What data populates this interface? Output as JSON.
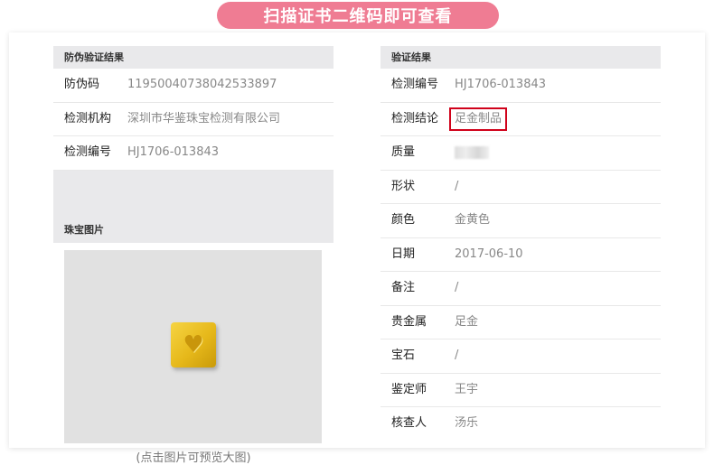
{
  "banner": {
    "title": "扫描证书二维码即可查看"
  },
  "anti_fake": {
    "heading": "防伪验证结果",
    "rows": [
      {
        "label": "防伪码",
        "value": "11950040738042533897"
      },
      {
        "label": "检测机构",
        "value": "深圳市华鉴珠宝检测有限公司"
      },
      {
        "label": "检测编号",
        "value": "HJ1706-013843"
      }
    ]
  },
  "photo": {
    "heading": "珠宝图片",
    "caption": "(点击图片可预览大图)"
  },
  "verify": {
    "heading": "验证结果",
    "rows": [
      {
        "label": "检测编号",
        "value": "HJ1706-013843"
      },
      {
        "label": "检测结论",
        "value": "足金制品"
      },
      {
        "label": "质量",
        "value": ""
      },
      {
        "label": "形状",
        "value": "/"
      },
      {
        "label": "颜色",
        "value": "金黄色"
      },
      {
        "label": "日期",
        "value": "2017-06-10"
      },
      {
        "label": "备注",
        "value": "/"
      },
      {
        "label": "贵金属",
        "value": "足金"
      },
      {
        "label": "宝石",
        "value": "/"
      },
      {
        "label": "鉴定师",
        "value": "王宇"
      },
      {
        "label": "核查人",
        "value": "汤乐"
      }
    ]
  },
  "colors": {
    "banner": "#ef7c93",
    "highlight_border": "#d0021b",
    "header_bg": "#e9e9eb"
  }
}
